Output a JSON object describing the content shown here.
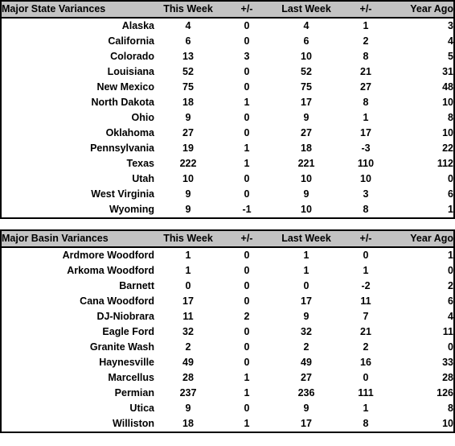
{
  "page": {
    "background_color": "#ffffff",
    "header_background_color": "#c3c3c3",
    "border_color": "#000000"
  },
  "tables": [
    {
      "id": "major-state-variances",
      "headers": {
        "label": "Major State Variances",
        "this_week": "This Week",
        "change_1": "+/-",
        "last_week": "Last Week",
        "change_2": "+/-",
        "year_ago": "Year Ago"
      },
      "rows": [
        {
          "label": "Alaska",
          "this_week": "4",
          "change_1": "0",
          "last_week": "4",
          "change_2": "1",
          "year_ago": "3"
        },
        {
          "label": "California",
          "this_week": "6",
          "change_1": "0",
          "last_week": "6",
          "change_2": "2",
          "year_ago": "4"
        },
        {
          "label": "Colorado",
          "this_week": "13",
          "change_1": "3",
          "last_week": "10",
          "change_2": "8",
          "year_ago": "5"
        },
        {
          "label": "Louisiana",
          "this_week": "52",
          "change_1": "0",
          "last_week": "52",
          "change_2": "21",
          "year_ago": "31"
        },
        {
          "label": "New Mexico",
          "this_week": "75",
          "change_1": "0",
          "last_week": "75",
          "change_2": "27",
          "year_ago": "48"
        },
        {
          "label": "North Dakota",
          "this_week": "18",
          "change_1": "1",
          "last_week": "17",
          "change_2": "8",
          "year_ago": "10"
        },
        {
          "label": "Ohio",
          "this_week": "9",
          "change_1": "0",
          "last_week": "9",
          "change_2": "1",
          "year_ago": "8"
        },
        {
          "label": "Oklahoma",
          "this_week": "27",
          "change_1": "0",
          "last_week": "27",
          "change_2": "17",
          "year_ago": "10"
        },
        {
          "label": "Pennsylvania",
          "this_week": "19",
          "change_1": "1",
          "last_week": "18",
          "change_2": "-3",
          "year_ago": "22"
        },
        {
          "label": "Texas",
          "this_week": "222",
          "change_1": "1",
          "last_week": "221",
          "change_2": "110",
          "year_ago": "112"
        },
        {
          "label": "Utah",
          "this_week": "10",
          "change_1": "0",
          "last_week": "10",
          "change_2": "10",
          "year_ago": "0"
        },
        {
          "label": "West Virginia",
          "this_week": "9",
          "change_1": "0",
          "last_week": "9",
          "change_2": "3",
          "year_ago": "6"
        },
        {
          "label": "Wyoming",
          "this_week": "9",
          "change_1": "-1",
          "last_week": "10",
          "change_2": "8",
          "year_ago": "1"
        }
      ]
    },
    {
      "id": "major-basin-variances",
      "headers": {
        "label": "Major Basin Variances",
        "this_week": "This Week",
        "change_1": "+/-",
        "last_week": "Last Week",
        "change_2": "+/-",
        "year_ago": "Year Ago"
      },
      "rows": [
        {
          "label": "Ardmore Woodford",
          "this_week": "1",
          "change_1": "0",
          "last_week": "1",
          "change_2": "0",
          "year_ago": "1"
        },
        {
          "label": "Arkoma Woodford",
          "this_week": "1",
          "change_1": "0",
          "last_week": "1",
          "change_2": "1",
          "year_ago": "0"
        },
        {
          "label": "Barnett",
          "this_week": "0",
          "change_1": "0",
          "last_week": "0",
          "change_2": "-2",
          "year_ago": "2"
        },
        {
          "label": "Cana Woodford",
          "this_week": "17",
          "change_1": "0",
          "last_week": "17",
          "change_2": "11",
          "year_ago": "6"
        },
        {
          "label": "DJ-Niobrara",
          "this_week": "11",
          "change_1": "2",
          "last_week": "9",
          "change_2": "7",
          "year_ago": "4"
        },
        {
          "label": "Eagle Ford",
          "this_week": "32",
          "change_1": "0",
          "last_week": "32",
          "change_2": "21",
          "year_ago": "11"
        },
        {
          "label": "Granite Wash",
          "this_week": "2",
          "change_1": "0",
          "last_week": "2",
          "change_2": "2",
          "year_ago": "0"
        },
        {
          "label": "Haynesville",
          "this_week": "49",
          "change_1": "0",
          "last_week": "49",
          "change_2": "16",
          "year_ago": "33"
        },
        {
          "label": "Marcellus",
          "this_week": "28",
          "change_1": "1",
          "last_week": "27",
          "change_2": "0",
          "year_ago": "28"
        },
        {
          "label": "Permian",
          "this_week": "237",
          "change_1": "1",
          "last_week": "236",
          "change_2": "111",
          "year_ago": "126"
        },
        {
          "label": "Utica",
          "this_week": "9",
          "change_1": "0",
          "last_week": "9",
          "change_2": "1",
          "year_ago": "8"
        },
        {
          "label": "Williston",
          "this_week": "18",
          "change_1": "1",
          "last_week": "17",
          "change_2": "8",
          "year_ago": "10"
        }
      ]
    }
  ]
}
